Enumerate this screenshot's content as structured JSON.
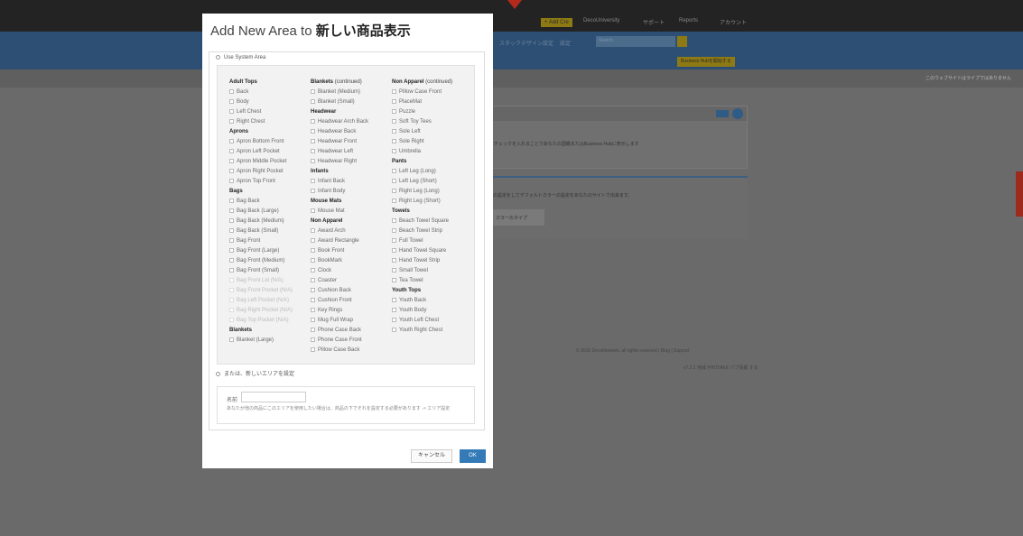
{
  "background": {
    "topbar": {
      "add_credits": "+ Add Cre",
      "university": "DecoUniversity",
      "support": "サポート",
      "reports": "Reports",
      "account": "アカウント"
    },
    "nav": {
      "stack_design": "スタックデザイン設定",
      "settings": "設定",
      "search_placeholder": "Search",
      "business_hub": "Business Hubを開始する"
    },
    "banner_text": "このウェブサイトはライブではありません",
    "panel1": {
      "button": "保存",
      "text": "にチェックを入れることであなたの国籍またはBusiness Hubに表示します"
    },
    "panel2": {
      "text": "用の設定をしてデフォルトカラーの設定をあなたのサイトで出来ます。",
      "color_type": "カラーのタイプ"
    },
    "footer": {
      "copyright": "© 2016 DecoNetwork, all rights reserved",
      "blog": "Blog",
      "support": "Support",
      "version": "v7.2.1 地域 PHOTAKE パブ情報 する"
    }
  },
  "modal": {
    "title_prefix": "Add New Area to",
    "title_product": "新しい商品表示",
    "use_system_area": "Use System Area",
    "or_new_area": "または、新しいエリアを設定",
    "name_label": "名前",
    "name_value": "",
    "help_text": "あなたが他の商品にこのエリアを使用したい場合は、商品の下でそれを設定する必要があります -> エリア設定",
    "cancel": "キャンセル",
    "ok": "OK",
    "columns": [
      [
        {
          "type": "header",
          "label": "Adult Tops"
        },
        {
          "type": "item",
          "label": "Back"
        },
        {
          "type": "item",
          "label": "Body"
        },
        {
          "type": "item",
          "label": "Left Chest"
        },
        {
          "type": "item",
          "label": "Right Chest"
        },
        {
          "type": "header",
          "label": "Aprons"
        },
        {
          "type": "item",
          "label": "Apron Bottom Front"
        },
        {
          "type": "item",
          "label": "Apron Left Pocket"
        },
        {
          "type": "item",
          "label": "Apron Middle Pocket"
        },
        {
          "type": "item",
          "label": "Apron Right Pocket"
        },
        {
          "type": "item",
          "label": "Apron Top Front"
        },
        {
          "type": "header",
          "label": "Bags"
        },
        {
          "type": "item",
          "label": "Bag Back"
        },
        {
          "type": "item",
          "label": "Bag Back (Large)"
        },
        {
          "type": "item",
          "label": "Bag Back (Medium)"
        },
        {
          "type": "item",
          "label": "Bag Back (Small)"
        },
        {
          "type": "item",
          "label": "Bag Front"
        },
        {
          "type": "item",
          "label": "Bag Front (Large)"
        },
        {
          "type": "item",
          "label": "Bag Front (Medium)"
        },
        {
          "type": "item",
          "label": "Bag Front (Small)"
        },
        {
          "type": "item",
          "label": "Bag Front Lid (N/A)",
          "disabled": true
        },
        {
          "type": "item",
          "label": "Bag Front Pocket (N/A)",
          "disabled": true
        },
        {
          "type": "item",
          "label": "Bag Left Pocket (N/A)",
          "disabled": true
        },
        {
          "type": "item",
          "label": "Bag Right Pocket (N/A)",
          "disabled": true
        },
        {
          "type": "item",
          "label": "Bag Top Pocket (N/A)",
          "disabled": true
        },
        {
          "type": "header",
          "label": "Blankets"
        },
        {
          "type": "item",
          "label": "Blanket (Large)"
        }
      ],
      [
        {
          "type": "header",
          "label": "Blankets",
          "sub": "(continued)"
        },
        {
          "type": "item",
          "label": "Blanket (Medium)"
        },
        {
          "type": "item",
          "label": "Blanket (Small)"
        },
        {
          "type": "header",
          "label": "Headwear"
        },
        {
          "type": "item",
          "label": "Headwear Arch Back"
        },
        {
          "type": "item",
          "label": "Headwear Back"
        },
        {
          "type": "item",
          "label": "Headwear Front"
        },
        {
          "type": "item",
          "label": "Headwear Left"
        },
        {
          "type": "item",
          "label": "Headwear Right"
        },
        {
          "type": "header",
          "label": "Infants"
        },
        {
          "type": "item",
          "label": "Infant Back"
        },
        {
          "type": "item",
          "label": "Infant Body"
        },
        {
          "type": "header",
          "label": "Mouse Mats"
        },
        {
          "type": "item",
          "label": "Mouse Mat"
        },
        {
          "type": "header",
          "label": "Non Apparel"
        },
        {
          "type": "item",
          "label": "Award Arch"
        },
        {
          "type": "item",
          "label": "Award Rectangle"
        },
        {
          "type": "item",
          "label": "Book Front"
        },
        {
          "type": "item",
          "label": "BookMark"
        },
        {
          "type": "item",
          "label": "Clock"
        },
        {
          "type": "item",
          "label": "Coaster"
        },
        {
          "type": "item",
          "label": "Cushion Back"
        },
        {
          "type": "item",
          "label": "Cushion Front"
        },
        {
          "type": "item",
          "label": "Key Rings"
        },
        {
          "type": "item",
          "label": "Mug Full Wrap"
        },
        {
          "type": "item",
          "label": "Phone Case Back"
        },
        {
          "type": "item",
          "label": "Phone Case Front"
        },
        {
          "type": "item",
          "label": "Pillow Case Back"
        }
      ],
      [
        {
          "type": "header",
          "label": "Non Apparel",
          "sub": "(continued)"
        },
        {
          "type": "item",
          "label": "Pillow Case Front"
        },
        {
          "type": "item",
          "label": "PlaceMat"
        },
        {
          "type": "item",
          "label": "Puzzle"
        },
        {
          "type": "item",
          "label": "Soft Toy Tees"
        },
        {
          "type": "item",
          "label": "Sole Left"
        },
        {
          "type": "item",
          "label": "Sole Right"
        },
        {
          "type": "item",
          "label": "Umbrella"
        },
        {
          "type": "header",
          "label": "Pants"
        },
        {
          "type": "item",
          "label": "Left Leg (Long)"
        },
        {
          "type": "item",
          "label": "Left Leg (Short)"
        },
        {
          "type": "item",
          "label": "Right Leg (Long)"
        },
        {
          "type": "item",
          "label": "Right Leg (Short)"
        },
        {
          "type": "header",
          "label": "Towels"
        },
        {
          "type": "item",
          "label": "Beach Towel Square"
        },
        {
          "type": "item",
          "label": "Beach Towel Strip"
        },
        {
          "type": "item",
          "label": "Full Towel"
        },
        {
          "type": "item",
          "label": "Hand Towel Square"
        },
        {
          "type": "item",
          "label": "Hand Towel Strip"
        },
        {
          "type": "item",
          "label": "Small Towel"
        },
        {
          "type": "item",
          "label": "Tea Towel"
        },
        {
          "type": "header",
          "label": "Youth Tops"
        },
        {
          "type": "item",
          "label": "Youth Back"
        },
        {
          "type": "item",
          "label": "Youth Body"
        },
        {
          "type": "item",
          "label": "Youth Left Chest"
        },
        {
          "type": "item",
          "label": "Youth Right Chest"
        }
      ]
    ]
  },
  "colors": {
    "primary": "#337ab7",
    "accent_yellow": "#8e7a14",
    "nav_blue": "#2d4f73",
    "overlay": "#6a6a6a"
  }
}
